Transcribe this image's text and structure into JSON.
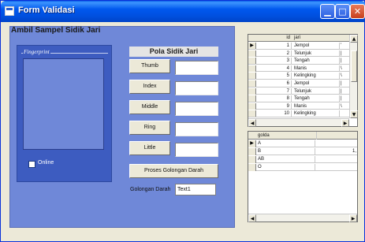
{
  "window": {
    "title": "Form Validasi",
    "buttons": {
      "minimize": "▁",
      "maximize": "□",
      "close": "✕"
    }
  },
  "panel": {
    "title": "Ambil Sampel Sidik Jari",
    "fingerprint_legend": "Fingerprint",
    "online_label": "Online"
  },
  "pola": {
    "header": "Pola Sidik Jari",
    "fingers": [
      "Thumb",
      "Index",
      "Middle",
      "Ring",
      "Little"
    ],
    "proses_label": "Proses Golongan Darah",
    "golongan_label": "Golongan Darah",
    "golongan_value": "Text1"
  },
  "grid1": {
    "headers": [
      "id",
      "jari"
    ],
    "rows": [
      {
        "id": "1",
        "jari": "Jempol",
        "c3": "'"
      },
      {
        "id": "2",
        "jari": "Telunjuk",
        "c3": "|"
      },
      {
        "id": "3",
        "jari": "Tengah",
        "c3": "|"
      },
      {
        "id": "4",
        "jari": "Manis",
        "c3": "\\"
      },
      {
        "id": "5",
        "jari": "Kelingking",
        "c3": "\\"
      },
      {
        "id": "6",
        "jari": "Jempol",
        "c3": "|"
      },
      {
        "id": "7",
        "jari": "Telunjuk",
        "c3": "|"
      },
      {
        "id": "8",
        "jari": "Tengah",
        "c3": "|"
      },
      {
        "id": "9",
        "jari": "Manis",
        "c3": "\\"
      },
      {
        "id": "10",
        "jari": "Kelingking",
        "c3": ""
      }
    ]
  },
  "grid2": {
    "headers": [
      "golda",
      ""
    ],
    "rows": [
      {
        "golda": "A",
        "val": ""
      },
      {
        "golda": "B",
        "val": "1,"
      },
      {
        "golda": "AB",
        "val": ""
      },
      {
        "golda": "O",
        "val": ""
      }
    ]
  },
  "icons": {
    "scroll_up": "▲",
    "scroll_down": "▼",
    "scroll_left": "◀",
    "scroll_right": "▶",
    "row_pointer": "▶"
  },
  "colors": {
    "titlebar": "#0054e3",
    "panel": "#6f88d8",
    "fingerprint_frame": "#3d5cc0"
  }
}
